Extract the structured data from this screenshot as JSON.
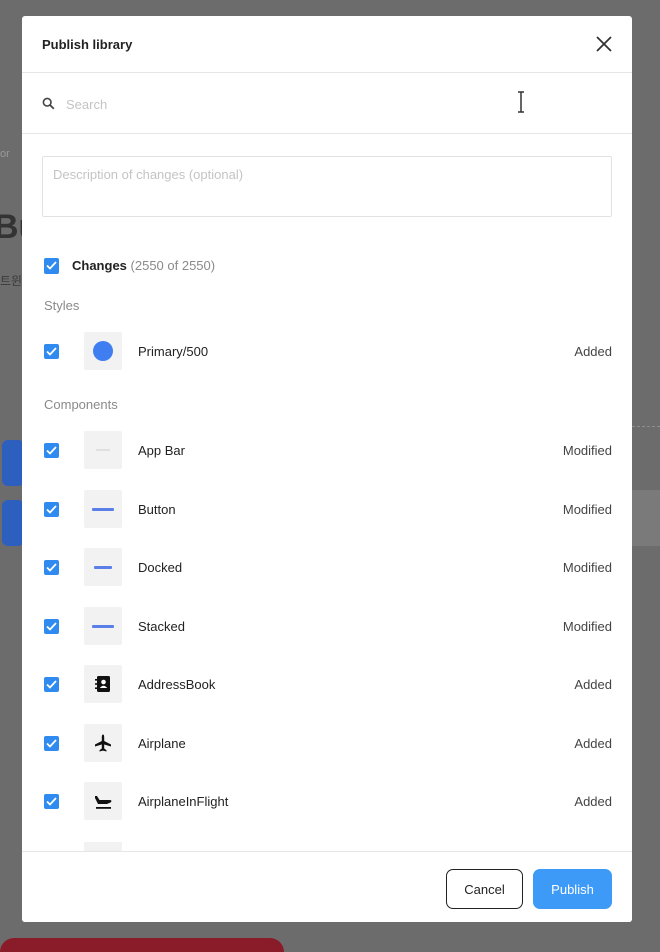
{
  "background": {
    "fragment_small": "or",
    "fragment_big": "Bu",
    "fragment_korean": "트윈"
  },
  "dialog": {
    "title": "Publish library",
    "close_icon": "close-icon",
    "search": {
      "placeholder": "Search",
      "value": "",
      "icon": "search-icon"
    },
    "description": {
      "placeholder": "Description of changes (optional)",
      "value": ""
    },
    "changes": {
      "label": "Changes",
      "count": "(2550 of 2550)",
      "checked": true
    },
    "styles_heading": "Styles",
    "styles": [
      {
        "name": "Primary/500",
        "status": "Added",
        "checked": true,
        "thumb": "color-swatch",
        "color": "#3f7ef0"
      }
    ],
    "components_heading": "Components",
    "components": [
      {
        "name": "App Bar",
        "status": "Modified",
        "checked": true,
        "thumb": "app-bar-thumbnail"
      },
      {
        "name": "Button",
        "status": "Modified",
        "checked": true,
        "thumb": "button-thumbnail"
      },
      {
        "name": "Docked",
        "status": "Modified",
        "checked": true,
        "thumb": "docked-thumbnail"
      },
      {
        "name": "Stacked",
        "status": "Modified",
        "checked": true,
        "thumb": "stacked-thumbnail"
      },
      {
        "name": "AddressBook",
        "status": "Added",
        "checked": true,
        "thumb": "address-book-icon"
      },
      {
        "name": "Airplane",
        "status": "Added",
        "checked": true,
        "thumb": "airplane-icon"
      },
      {
        "name": "AirplaneInFlight",
        "status": "Added",
        "checked": true,
        "thumb": "airplane-in-flight-icon"
      }
    ],
    "footer": {
      "cancel_label": "Cancel",
      "publish_label": "Publish"
    },
    "colors": {
      "accent": "#3d9bf7",
      "checkbox": "#2f8bef"
    }
  }
}
